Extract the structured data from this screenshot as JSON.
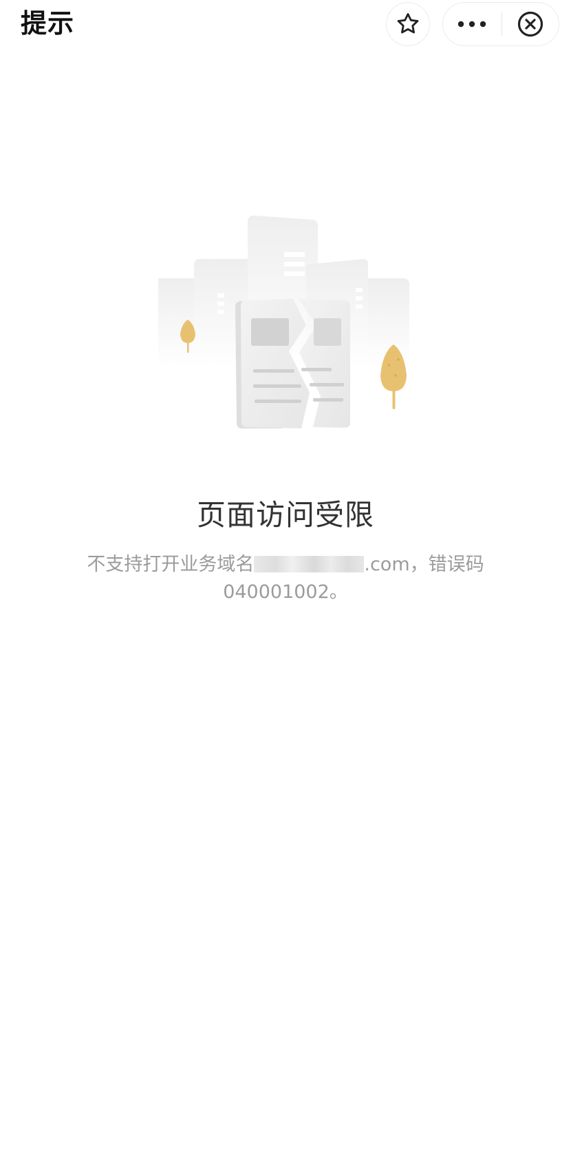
{
  "header": {
    "title": "提示",
    "favorite_icon": "star-icon",
    "more_icon": "more-dots-icon",
    "close_icon": "close-circle-icon"
  },
  "error": {
    "illustration_icon": "broken-page-icon",
    "title": "页面访问受限",
    "message_prefix": "不支持打开业务域名",
    "message_domain_suffix": ".com",
    "message_suffix": "，错误码040001002。"
  },
  "colors": {
    "tree": "#e8c170",
    "title_text": "#333333",
    "desc_text": "#9b9b9b"
  }
}
